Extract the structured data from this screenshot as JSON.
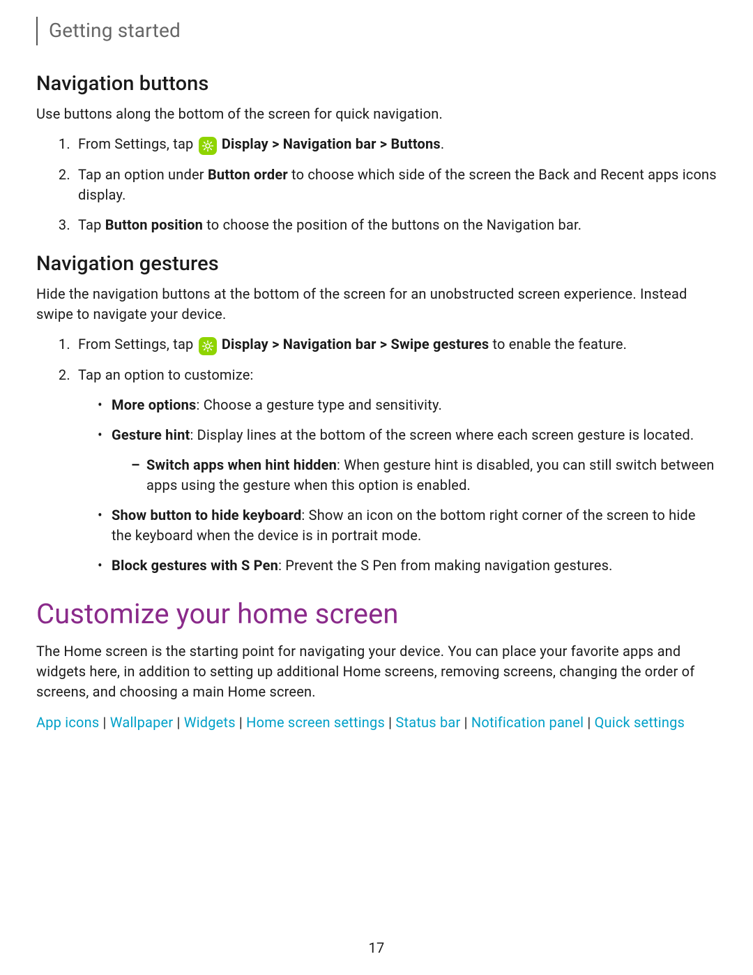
{
  "header": {
    "breadcrumb": "Getting started"
  },
  "navButtons": {
    "heading": "Navigation buttons",
    "intro": "Use buttons along the bottom of the screen for quick navigation.",
    "step1_pre": "From Settings, tap ",
    "step1_bold": "Display > Navigation bar > Buttons",
    "step1_post": ".",
    "step2_a": "Tap an option under ",
    "step2_bold": "Button order",
    "step2_b": " to choose which side of the screen the Back and Recent apps icons display.",
    "step3_a": "Tap ",
    "step3_bold": "Button position",
    "step3_b": " to choose the position of the buttons on the Navigation bar."
  },
  "navGestures": {
    "heading": "Navigation gestures",
    "intro": "Hide the navigation buttons at the bottom of the screen for an unobstructed screen experience. Instead swipe to navigate your device.",
    "step1_pre": "From Settings, tap ",
    "step1_bold": "Display > Navigation bar > Swipe gestures",
    "step1_post": " to enable the feature.",
    "step2": "Tap an option to customize:",
    "opt1_bold": "More options",
    "opt1_text": ": Choose a gesture type and sensitivity.",
    "opt2_bold": "Gesture hint",
    "opt2_text": ": Display lines at the bottom of the screen where each screen gesture is located.",
    "opt2_sub_bold": "Switch apps when hint hidden",
    "opt2_sub_text": ": When gesture hint is disabled, you can still switch between apps using the gesture when this option is enabled.",
    "opt3_bold": "Show button to hide keyboard",
    "opt3_text": ": Show an icon on the bottom right corner of the screen to hide the keyboard when the device is in portrait mode.",
    "opt4_bold": "Block gestures with S Pen",
    "opt4_text": ": Prevent the S Pen from making navigation gestures."
  },
  "customize": {
    "heading": "Customize your home screen",
    "intro": "The Home screen is the starting point for navigating your device. You can place your favorite apps and widgets here, in addition to setting up additional Home screens, removing screens, changing the order of screens, and choosing a main Home screen.",
    "links": {
      "appIcons": "App icons",
      "wallpaper": "Wallpaper",
      "widgets": "Widgets",
      "homeScreenSettings": "Home screen settings",
      "statusBar": "Status bar",
      "notificationPanel": "Notification panel",
      "quickSettings": "Quick settings"
    }
  },
  "sep": " | ",
  "pageNumber": "17"
}
